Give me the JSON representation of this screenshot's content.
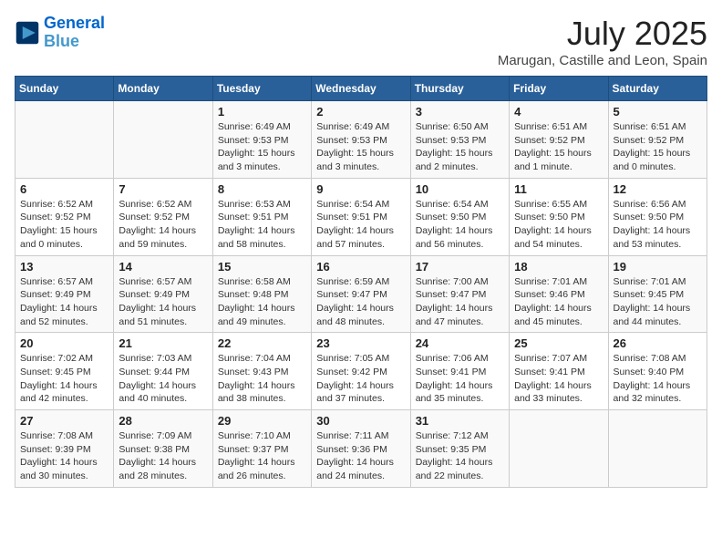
{
  "header": {
    "logo_line1": "General",
    "logo_line2": "Blue",
    "month": "July 2025",
    "location": "Marugan, Castille and Leon, Spain"
  },
  "weekdays": [
    "Sunday",
    "Monday",
    "Tuesday",
    "Wednesday",
    "Thursday",
    "Friday",
    "Saturday"
  ],
  "weeks": [
    [
      {
        "day": "",
        "info": ""
      },
      {
        "day": "",
        "info": ""
      },
      {
        "day": "1",
        "info": "Sunrise: 6:49 AM\nSunset: 9:53 PM\nDaylight: 15 hours and 3 minutes."
      },
      {
        "day": "2",
        "info": "Sunrise: 6:49 AM\nSunset: 9:53 PM\nDaylight: 15 hours and 3 minutes."
      },
      {
        "day": "3",
        "info": "Sunrise: 6:50 AM\nSunset: 9:53 PM\nDaylight: 15 hours and 2 minutes."
      },
      {
        "day": "4",
        "info": "Sunrise: 6:51 AM\nSunset: 9:52 PM\nDaylight: 15 hours and 1 minute."
      },
      {
        "day": "5",
        "info": "Sunrise: 6:51 AM\nSunset: 9:52 PM\nDaylight: 15 hours and 0 minutes."
      }
    ],
    [
      {
        "day": "6",
        "info": "Sunrise: 6:52 AM\nSunset: 9:52 PM\nDaylight: 15 hours and 0 minutes."
      },
      {
        "day": "7",
        "info": "Sunrise: 6:52 AM\nSunset: 9:52 PM\nDaylight: 14 hours and 59 minutes."
      },
      {
        "day": "8",
        "info": "Sunrise: 6:53 AM\nSunset: 9:51 PM\nDaylight: 14 hours and 58 minutes."
      },
      {
        "day": "9",
        "info": "Sunrise: 6:54 AM\nSunset: 9:51 PM\nDaylight: 14 hours and 57 minutes."
      },
      {
        "day": "10",
        "info": "Sunrise: 6:54 AM\nSunset: 9:50 PM\nDaylight: 14 hours and 56 minutes."
      },
      {
        "day": "11",
        "info": "Sunrise: 6:55 AM\nSunset: 9:50 PM\nDaylight: 14 hours and 54 minutes."
      },
      {
        "day": "12",
        "info": "Sunrise: 6:56 AM\nSunset: 9:50 PM\nDaylight: 14 hours and 53 minutes."
      }
    ],
    [
      {
        "day": "13",
        "info": "Sunrise: 6:57 AM\nSunset: 9:49 PM\nDaylight: 14 hours and 52 minutes."
      },
      {
        "day": "14",
        "info": "Sunrise: 6:57 AM\nSunset: 9:49 PM\nDaylight: 14 hours and 51 minutes."
      },
      {
        "day": "15",
        "info": "Sunrise: 6:58 AM\nSunset: 9:48 PM\nDaylight: 14 hours and 49 minutes."
      },
      {
        "day": "16",
        "info": "Sunrise: 6:59 AM\nSunset: 9:47 PM\nDaylight: 14 hours and 48 minutes."
      },
      {
        "day": "17",
        "info": "Sunrise: 7:00 AM\nSunset: 9:47 PM\nDaylight: 14 hours and 47 minutes."
      },
      {
        "day": "18",
        "info": "Sunrise: 7:01 AM\nSunset: 9:46 PM\nDaylight: 14 hours and 45 minutes."
      },
      {
        "day": "19",
        "info": "Sunrise: 7:01 AM\nSunset: 9:45 PM\nDaylight: 14 hours and 44 minutes."
      }
    ],
    [
      {
        "day": "20",
        "info": "Sunrise: 7:02 AM\nSunset: 9:45 PM\nDaylight: 14 hours and 42 minutes."
      },
      {
        "day": "21",
        "info": "Sunrise: 7:03 AM\nSunset: 9:44 PM\nDaylight: 14 hours and 40 minutes."
      },
      {
        "day": "22",
        "info": "Sunrise: 7:04 AM\nSunset: 9:43 PM\nDaylight: 14 hours and 38 minutes."
      },
      {
        "day": "23",
        "info": "Sunrise: 7:05 AM\nSunset: 9:42 PM\nDaylight: 14 hours and 37 minutes."
      },
      {
        "day": "24",
        "info": "Sunrise: 7:06 AM\nSunset: 9:41 PM\nDaylight: 14 hours and 35 minutes."
      },
      {
        "day": "25",
        "info": "Sunrise: 7:07 AM\nSunset: 9:41 PM\nDaylight: 14 hours and 33 minutes."
      },
      {
        "day": "26",
        "info": "Sunrise: 7:08 AM\nSunset: 9:40 PM\nDaylight: 14 hours and 32 minutes."
      }
    ],
    [
      {
        "day": "27",
        "info": "Sunrise: 7:08 AM\nSunset: 9:39 PM\nDaylight: 14 hours and 30 minutes."
      },
      {
        "day": "28",
        "info": "Sunrise: 7:09 AM\nSunset: 9:38 PM\nDaylight: 14 hours and 28 minutes."
      },
      {
        "day": "29",
        "info": "Sunrise: 7:10 AM\nSunset: 9:37 PM\nDaylight: 14 hours and 26 minutes."
      },
      {
        "day": "30",
        "info": "Sunrise: 7:11 AM\nSunset: 9:36 PM\nDaylight: 14 hours and 24 minutes."
      },
      {
        "day": "31",
        "info": "Sunrise: 7:12 AM\nSunset: 9:35 PM\nDaylight: 14 hours and 22 minutes."
      },
      {
        "day": "",
        "info": ""
      },
      {
        "day": "",
        "info": ""
      }
    ]
  ]
}
